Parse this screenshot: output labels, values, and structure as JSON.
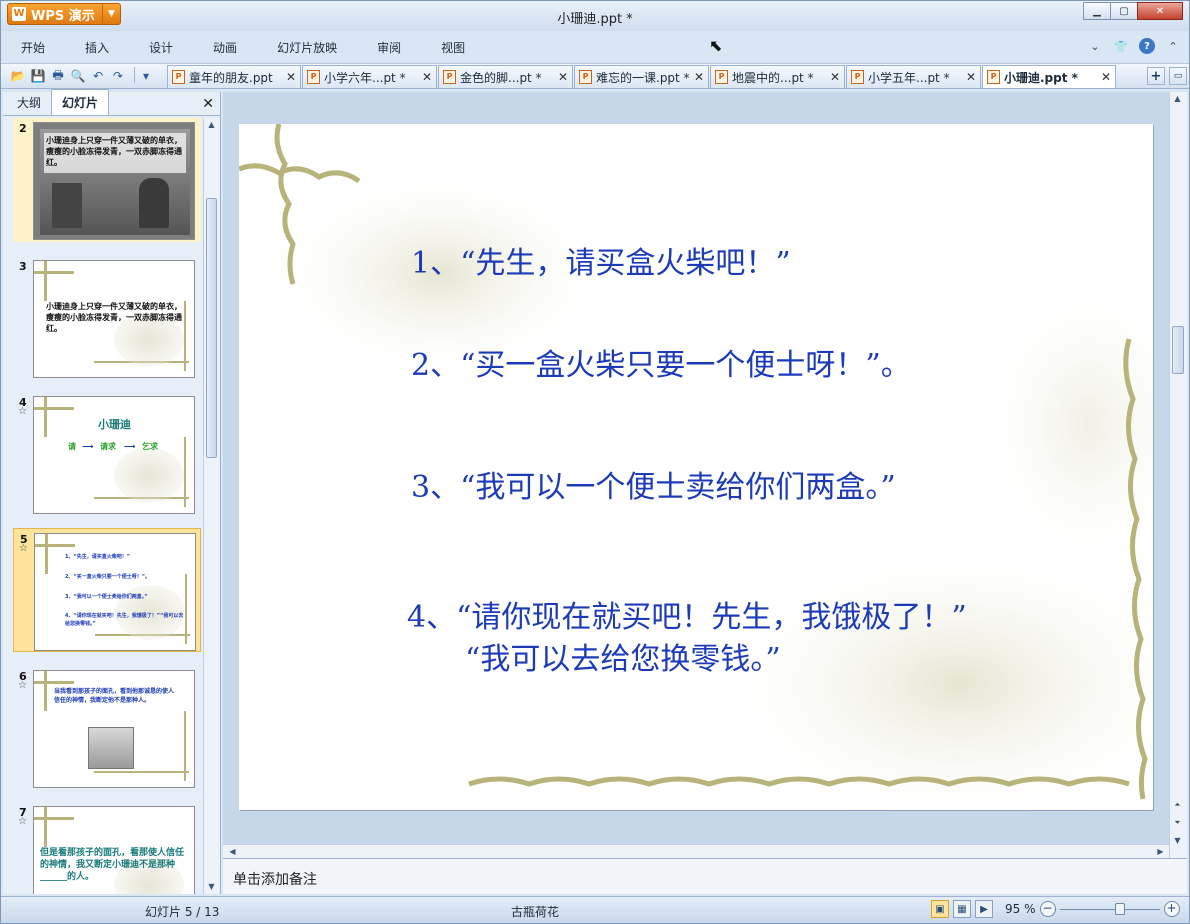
{
  "app": {
    "brand": "WPS 演示",
    "logo_char": "W",
    "window_title": "小珊迪.ppt *"
  },
  "menu": [
    "开始",
    "插入",
    "设计",
    "动画",
    "幻灯片放映",
    "审阅",
    "视图"
  ],
  "doc_tabs": [
    {
      "label": "童年的朋友.ppt",
      "active": false
    },
    {
      "label": "小学六年...pt *",
      "active": false
    },
    {
      "label": "金色的脚...pt *",
      "active": false
    },
    {
      "label": "难忘的一课.ppt *",
      "active": false
    },
    {
      "label": "地震中的...pt *",
      "active": false
    },
    {
      "label": "小学五年...pt *",
      "active": false
    },
    {
      "label": "小珊迪.ppt *",
      "active": true
    }
  ],
  "left_pane": {
    "tabs": [
      "大纲",
      "幻灯片"
    ],
    "active_tab": "幻灯片",
    "thumbnails": [
      {
        "num": "2",
        "star": false,
        "selected": false,
        "text": "小珊迪身上只穿一件又薄又破的单衣，瘦瘦的小脸冻得发青，一双赤脚冻得通红。"
      },
      {
        "num": "3",
        "star": false,
        "selected": false,
        "text": "小珊迪身上只穿一件又薄又破的单衣，瘦瘦的小脸冻得发青，一双赤脚冻得通红。"
      },
      {
        "num": "4",
        "star": true,
        "selected": false,
        "title": "小珊迪",
        "flow": [
          "请",
          "请求",
          "乞求"
        ]
      },
      {
        "num": "5",
        "star": true,
        "selected": true,
        "lines": [
          "1、“先生，请买盒火柴吧！”",
          "2、“买一盒火柴只要一个便士呀！”。",
          "3、“我可以一个便士卖给你们两盒。”",
          "4、“请你现在就买吧！先生，我饿极了！”“我可以去给您换零钱。”"
        ]
      },
      {
        "num": "6",
        "star": true,
        "selected": false,
        "text": "当我看到那孩子的面孔，看到他那诚恳的使人信任的神情，我断定他不是那种人。"
      },
      {
        "num": "7",
        "star": true,
        "selected": false,
        "text": "但是看那孩子的面孔，看那使人信任的神情，我又断定小珊迪不是那种______的人。"
      }
    ]
  },
  "slide": {
    "lines": [
      "1、“先生，请买盒火柴吧！”",
      "2、“买一盒火柴只要一个便士呀！”。",
      "3、“我可以一个便士卖给你们两盒。”",
      "4、“请你现在就买吧！先生，我饿极了！”",
      "“我可以去给您换零钱。”"
    ],
    "text_color": "#1d3bb8"
  },
  "notes": {
    "placeholder": "单击添加备注"
  },
  "status": {
    "slide_info": "幻灯片 5 / 13",
    "theme": "古瓶荷花",
    "zoom": "95 %",
    "zoom_value": 95
  }
}
